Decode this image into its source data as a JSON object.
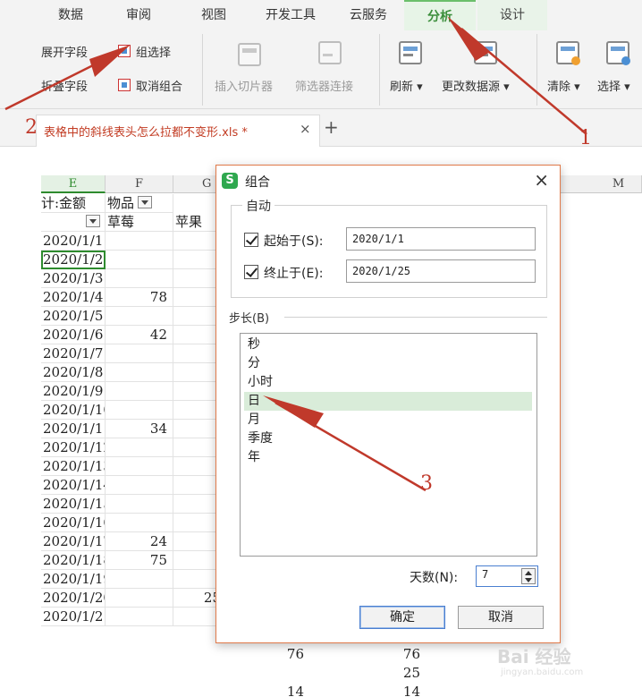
{
  "ribbon": {
    "tabs": [
      {
        "label": "数据"
      },
      {
        "label": "审阅"
      },
      {
        "label": "视图"
      },
      {
        "label": "开发工具"
      },
      {
        "label": "云服务"
      },
      {
        "label": "分析"
      },
      {
        "label": "设计"
      }
    ],
    "expand_field": "展开字段",
    "collapse_field": "折叠字段",
    "group_select": "组选择",
    "ungroup": "取消组合",
    "insert_slicer": "插入切片器",
    "filter_connect": "筛选器连接",
    "refresh": "刷新 ▾",
    "change_source": "更改数据源 ▾",
    "clear": "清除 ▾",
    "select": "选择 ▾"
  },
  "document": {
    "tab_label": "表格中的斜线表头怎么拉都不变形.xls *",
    "close": "×",
    "new_tab": "+"
  },
  "sheet": {
    "columns": [
      "E",
      "F",
      "G",
      "M"
    ],
    "header_row1": [
      "计:金额",
      "物品"
    ],
    "header_row2": [
      "草莓",
      "苹果"
    ],
    "rows": [
      {
        "date": "2020/1/1",
        "f": "",
        "g": ""
      },
      {
        "date": "2020/1/2",
        "f": "",
        "g": ""
      },
      {
        "date": "2020/1/3",
        "f": "",
        "g": ""
      },
      {
        "date": "2020/1/4",
        "f": "78",
        "g": ""
      },
      {
        "date": "2020/1/5",
        "f": "",
        "g": ""
      },
      {
        "date": "2020/1/6",
        "f": "42",
        "g": ""
      },
      {
        "date": "2020/1/7",
        "f": "",
        "g": ""
      },
      {
        "date": "2020/1/8",
        "f": "",
        "g": ""
      },
      {
        "date": "2020/1/9",
        "f": "",
        "g": ""
      },
      {
        "date": "2020/1/10",
        "f": "",
        "g": ""
      },
      {
        "date": "2020/1/11",
        "f": "34",
        "g": ""
      },
      {
        "date": "2020/1/12",
        "f": "",
        "g": ""
      },
      {
        "date": "2020/1/13",
        "f": "",
        "g": ""
      },
      {
        "date": "2020/1/14",
        "f": "",
        "g": ""
      },
      {
        "date": "2020/1/15",
        "f": "",
        "g": ""
      },
      {
        "date": "2020/1/16",
        "f": "",
        "g": ""
      },
      {
        "date": "2020/1/17",
        "f": "24",
        "g": ""
      },
      {
        "date": "2020/1/18",
        "f": "75",
        "g": ""
      },
      {
        "date": "2020/1/19",
        "f": "",
        "g": ""
      },
      {
        "date": "2020/1/20",
        "f": "",
        "g": "25"
      },
      {
        "date": "2020/1/21",
        "f": "",
        "g": ""
      }
    ],
    "extra_values": {
      "r19_a": "76",
      "r19_b": "76",
      "r20_b": "25",
      "r21_a": "14",
      "r21_b": "14"
    }
  },
  "dialog": {
    "logo": "S",
    "title": "组合",
    "close": "×",
    "auto_legend": "自动",
    "start_label": "起始于(S):",
    "start_value": "2020/1/1",
    "end_label": "终止于(E):",
    "end_value": "2020/1/25",
    "step_label": "步长(B)",
    "steps": [
      "秒",
      "分",
      "小时",
      "日",
      "月",
      "季度",
      "年"
    ],
    "selected_step": "日",
    "days_label": "天数(N):",
    "days_value": "7",
    "ok": "确定",
    "cancel": "取消"
  },
  "annotations": {
    "one": "1",
    "two": "2",
    "three": "3",
    "color": "#c0392b"
  },
  "watermark": {
    "main": "Bai 经验",
    "sub": "jingyan.baidu.com"
  }
}
